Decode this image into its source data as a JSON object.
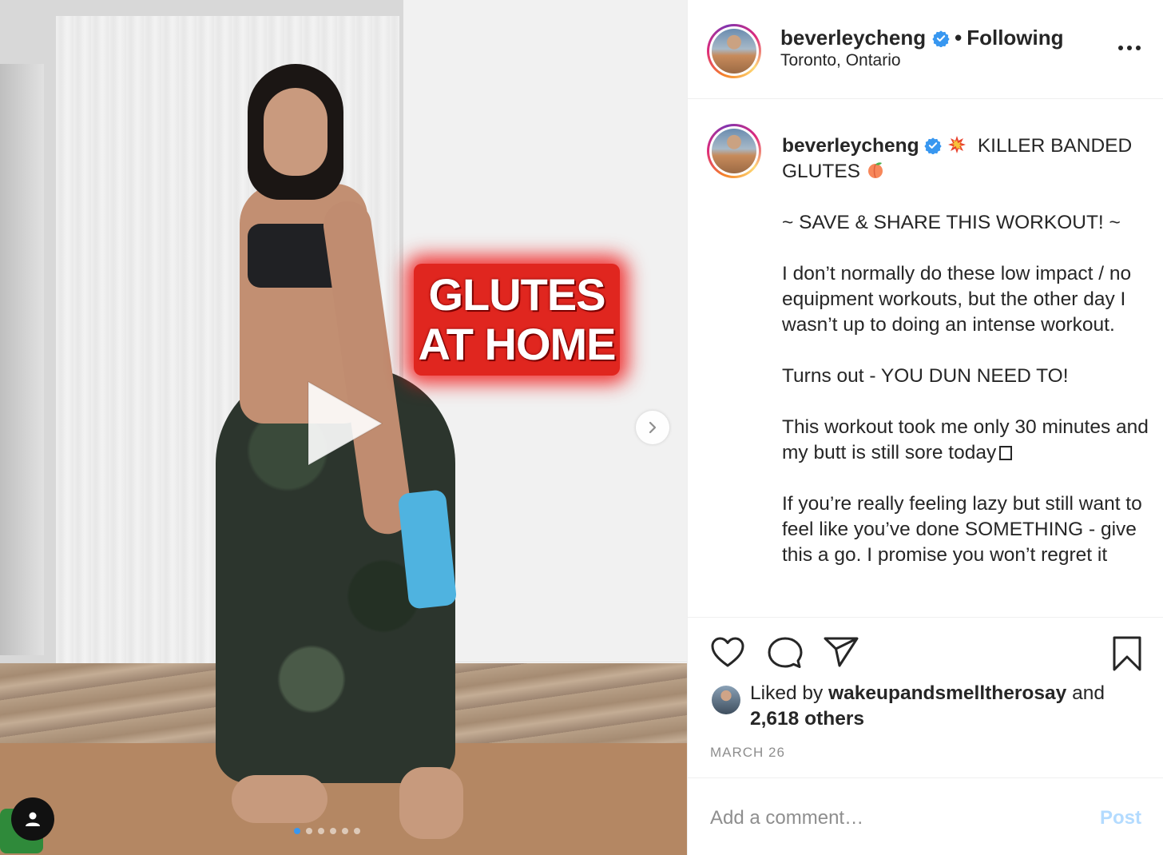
{
  "post": {
    "username": "beverleycheng",
    "separator": "•",
    "follow_status": "Following",
    "location": "Toronto, Ontario",
    "media": {
      "overlay_text_line1": "GLUTES",
      "overlay_text_line2": "AT HOME",
      "carousel_dot_count": 6,
      "active_dot_index": 0
    },
    "caption": {
      "username": "beverleycheng",
      "title": "KILLER BANDED GLUTES",
      "paragraphs": [
        "~ SAVE & SHARE THIS WORKOUT! ~",
        "I don’t normally do these low impact / no equipment workouts, but the other day I wasn’t up to doing an intense workout.",
        "Turns out - YOU DUN NEED TO!",
        "This workout took me only 30 minutes and my butt is still sore today",
        "If you’re really feeling lazy but still want to feel like you’ve done SOMETHING - give this a go. I promise you won’t regret it"
      ]
    },
    "likes": {
      "prefix": "Liked by",
      "liker": "wakeupandsmelltherosay",
      "conjunction": "and",
      "others": "2,618 others"
    },
    "date": "MARCH 26",
    "comment": {
      "placeholder": "Add a comment…",
      "post_label": "Post"
    }
  },
  "icons": {
    "verified": "verified-badge-icon",
    "collision": "collision-emoji-icon",
    "peach": "peach-emoji-icon",
    "more": "more-options-icon",
    "like": "heart-icon",
    "comment": "comment-bubble-icon",
    "share": "paper-plane-icon",
    "save": "bookmark-icon",
    "play": "play-icon",
    "next": "chevron-right-icon",
    "user_tag": "user-tag-icon"
  },
  "colors": {
    "verified_blue": "#3897f0",
    "post_button_disabled": "#b3dbff",
    "overlay_red": "#e0261f",
    "muted_gray": "#8e8e8e"
  }
}
